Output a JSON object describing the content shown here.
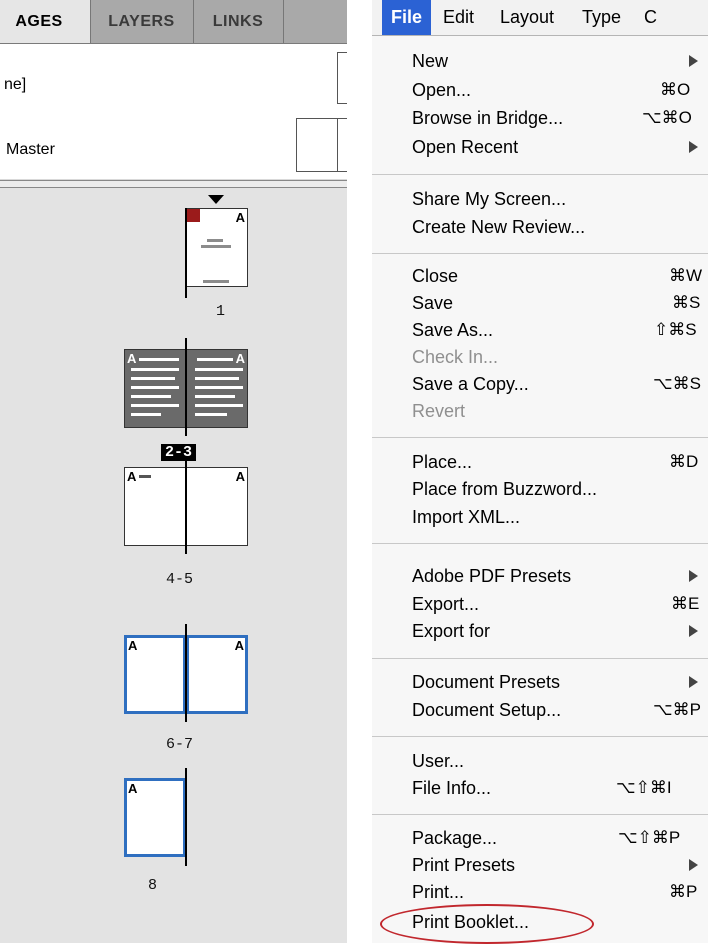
{
  "pages_panel": {
    "tabs": {
      "pages": "AGES",
      "layers": "LAYERS",
      "links": "LINKS"
    },
    "masters": {
      "none_label": "ne]",
      "a_master_label": "Master"
    },
    "spreads": {
      "s1": {
        "label": "1",
        "master": "A"
      },
      "s23": {
        "label": "2-3",
        "master_left": "A",
        "master_right": "A"
      },
      "s45": {
        "label": "4-5",
        "master_left": "A",
        "master_right": "A"
      },
      "s67": {
        "label": "6-7",
        "master_left": "A",
        "master_right": "A"
      },
      "s8": {
        "label": "8",
        "master": "A"
      }
    }
  },
  "menubar": {
    "file": "File",
    "edit": "Edit",
    "layout": "Layout",
    "type": "Type",
    "more": "C"
  },
  "menu": {
    "new": "New",
    "open": "Open...",
    "open_sc": "⌘O",
    "browse": "Browse in Bridge...",
    "browse_sc": "⌥⌘O",
    "open_recent": "Open Recent",
    "share": "Share My Screen...",
    "create_review": "Create New Review...",
    "close": "Close",
    "close_sc": "⌘W",
    "save": "Save",
    "save_sc": "⌘S",
    "save_as": "Save As...",
    "save_as_sc": "⇧⌘S",
    "check_in": "Check In...",
    "save_copy": "Save a Copy...",
    "save_copy_sc": "⌥⌘S",
    "revert": "Revert",
    "place": "Place...",
    "place_sc": "⌘D",
    "place_buzz": "Place from Buzzword...",
    "import_xml": "Import XML...",
    "pdf_presets": "Adobe PDF Presets",
    "export": "Export...",
    "export_sc": "⌘E",
    "export_for": "Export for",
    "doc_presets": "Document Presets",
    "doc_setup": "Document Setup...",
    "doc_setup_sc": "⌥⌘P",
    "user": "User...",
    "file_info": "File Info...",
    "file_info_sc": "⌥⇧⌘I",
    "package": "Package...",
    "package_sc": "⌥⇧⌘P",
    "print_presets": "Print Presets",
    "print": "Print...",
    "print_sc": "⌘P",
    "print_booklet": "Print Booklet..."
  },
  "colors": {
    "menu_highlight": "#2b62d4",
    "annotation_circle": "#c1272d",
    "selected_page_border": "#2f6fc0"
  }
}
